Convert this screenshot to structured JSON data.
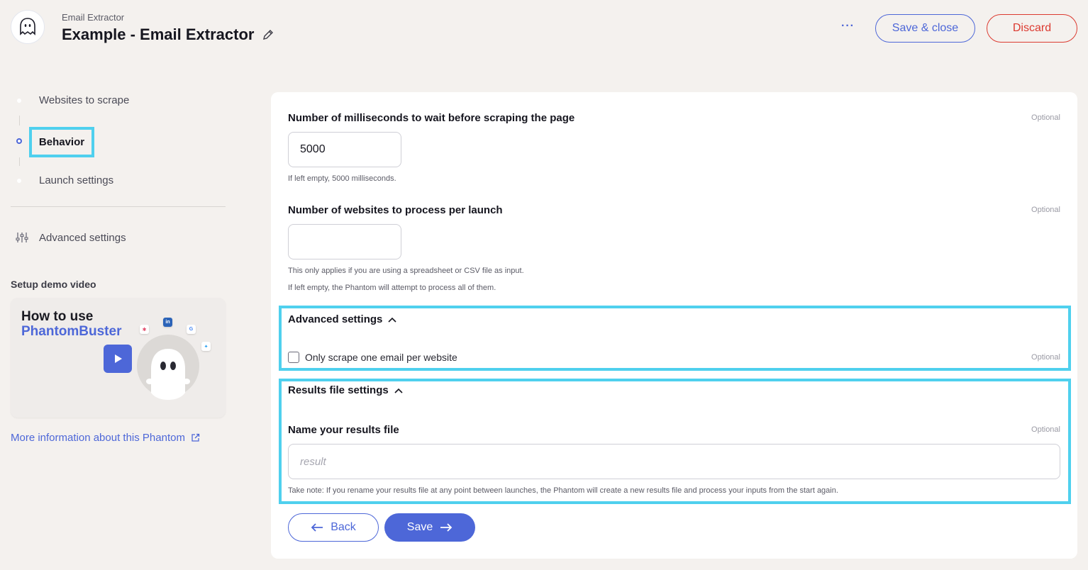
{
  "header": {
    "app_name": "Email Extractor",
    "title": "Example - Email Extractor",
    "more_label": "···",
    "save_close_label": "Save & close",
    "discard_label": "Discard"
  },
  "sidebar": {
    "steps": [
      {
        "label": "Websites to scrape",
        "state": "done"
      },
      {
        "label": "Behavior",
        "state": "active"
      },
      {
        "label": "Launch settings",
        "state": "pending"
      }
    ],
    "advanced_label": "Advanced settings",
    "demo_title": "Setup demo video",
    "video": {
      "line1": "How to use",
      "line2": "PhantomBuster"
    },
    "more_info_label": "More information about this Phantom"
  },
  "main": {
    "wait_field": {
      "label": "Number of milliseconds to wait before scraping the page",
      "optional": "Optional",
      "value": "5000",
      "hint": "If left empty, 5000 milliseconds."
    },
    "websites_field": {
      "label": "Number of websites to process per launch",
      "optional": "Optional",
      "value": "",
      "hint1": "This only applies if you are using a spreadsheet or CSV file as input.",
      "hint2": "If left empty, the Phantom will attempt to process all of them."
    },
    "advanced_section": {
      "title": "Advanced settings",
      "checkbox_label": "Only scrape one email per website",
      "checked": false,
      "optional": "Optional"
    },
    "results_section": {
      "title": "Results file settings",
      "field_label": "Name your results file",
      "optional": "Optional",
      "placeholder": "result",
      "note": "Take note: If you rename your results file at any point between launches, the Phantom will create a new results file and process your inputs from the start again."
    },
    "back_label": "Back",
    "save_label": "Save"
  },
  "colors": {
    "accent": "#4d67d8",
    "danger": "#dc3a30",
    "highlight": "#4fd0ee",
    "background": "#f4f1ee"
  }
}
